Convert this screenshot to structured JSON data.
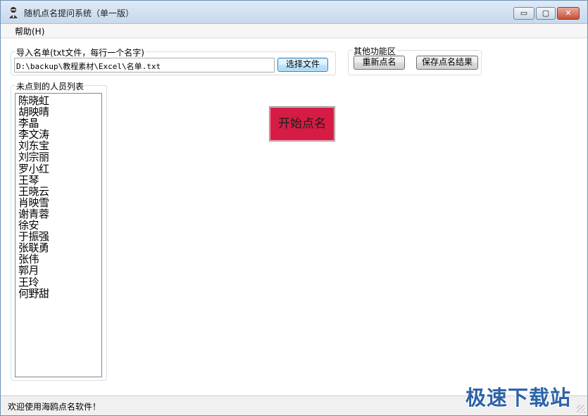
{
  "window": {
    "title": "随机点名提问系统（单一版）",
    "controls": {
      "minimize": "▭",
      "maximize": "▢",
      "close": "✕"
    }
  },
  "menu": {
    "help": "帮助(H)"
  },
  "import_group": {
    "label": "导入名单(txt文件，每行一个名字)",
    "path_value": "D:\\backup\\教程素材\\Excel\\名单.txt",
    "choose_button": "选择文件"
  },
  "other_group": {
    "label": "其他功能区",
    "reset_button": "重新点名",
    "save_button": "保存点名结果"
  },
  "list_group": {
    "label": "未点到的人员列表",
    "items": [
      "陈晓虹",
      "胡映晴",
      "李晶",
      "李文涛",
      "刘东宝",
      "刘宗丽",
      "罗小红",
      "王琴",
      "王晓云",
      "肖映雪",
      "谢青蓉",
      "徐安",
      "于振强",
      "张联勇",
      "张伟",
      "郭月",
      "王玲",
      "何野甜"
    ]
  },
  "start_button": "开始点名",
  "status": {
    "text": "欢迎使用海鸥点名软件！"
  },
  "watermark": "极速下载站",
  "colors": {
    "start_button_bg": "#d61c44",
    "watermark": "#2d63a8"
  }
}
